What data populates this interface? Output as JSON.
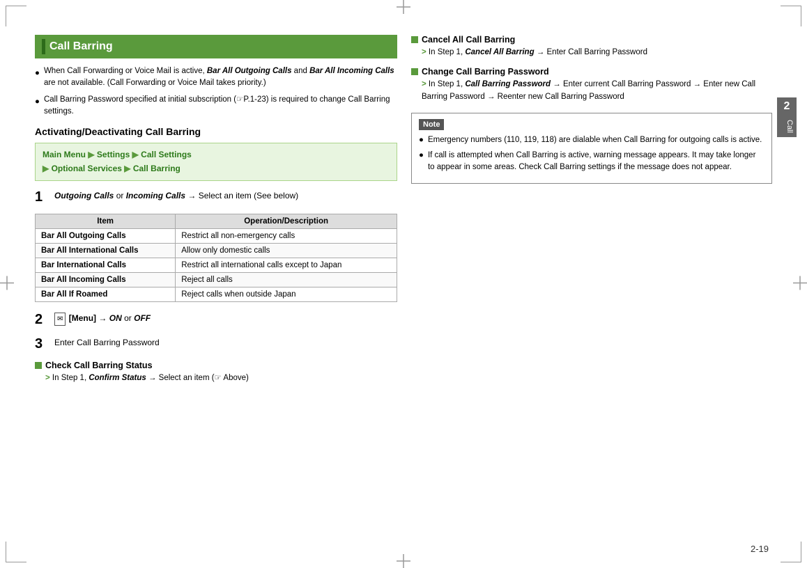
{
  "page": {
    "number": "2-19",
    "chapter_num": "2",
    "chapter_label": "Call"
  },
  "title": "Call Barring",
  "bullets": [
    "When Call Forwarding or Voice Mail is active, Bar All Outgoing Calls and Bar All Incoming Calls are not available. (Call Forwarding or Voice Mail takes priority.)",
    "Call Barring Password specified at initial subscription (☞P.1-23) is required to change Call Barring settings."
  ],
  "activating_heading": "Activating/Deactivating Call Barring",
  "menu_path": {
    "line1_parts": [
      "Main Menu",
      "Settings",
      "Call Settings"
    ],
    "line2_parts": [
      "Optional Services",
      "Call Barring"
    ]
  },
  "step1": {
    "number": "1",
    "text_pre": "",
    "outgoing": "Outgoing Calls",
    "or1": " or ",
    "incoming": "Incoming Calls",
    "arrow": "→",
    "text_post": " Select an item (See below)"
  },
  "table": {
    "headers": [
      "Item",
      "Operation/Description"
    ],
    "rows": [
      [
        "Bar All Outgoing Calls",
        "Restrict all non-emergency calls"
      ],
      [
        "Bar All International Calls",
        "Allow only domestic calls"
      ],
      [
        "Bar International Calls",
        "Restrict all international calls except to Japan"
      ],
      [
        "Bar All Incoming Calls",
        "Reject all calls"
      ],
      [
        "Bar All If Roamed",
        "Reject calls when outside Japan"
      ]
    ]
  },
  "step2": {
    "number": "2",
    "menu_label": "[Menu]",
    "arrow": "→",
    "on": "ON",
    "or2": " or ",
    "off": "OFF"
  },
  "step3": {
    "number": "3",
    "text": "Enter Call Barring Password"
  },
  "check_status": {
    "header": "Check Call Barring Status",
    "content": "In Step 1, Confirm Status → Select an item (☞ Above)"
  },
  "cancel_barring": {
    "header": "Cancel All Call Barring",
    "content": "In Step 1, Cancel All Barring → Enter Call Barring Password"
  },
  "change_password": {
    "header": "Change Call Barring Password",
    "content": "In Step 1, Call Barring Password → Enter current Call Barring Password → Enter new Call Barring Password → Reenter new Call Barring Password"
  },
  "note": {
    "header": "Note",
    "items": [
      "Emergency numbers (110, 119, 118) are dialable when Call Barring for outgoing calls is active.",
      "If call is attempted when Call Barring is active, warning message appears. It may take longer to appear in some areas. Check Call Barring settings if the message does not appear."
    ]
  }
}
